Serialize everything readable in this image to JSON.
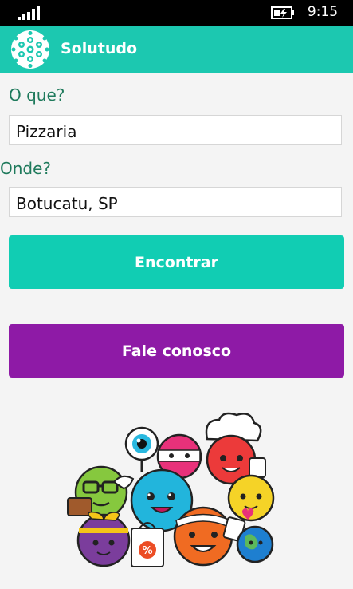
{
  "status_bar": {
    "time": "9:15",
    "signal_icon": "signal-bars-icon",
    "battery_icon": "battery-charging-icon"
  },
  "app": {
    "title": "Solutudo",
    "logo_icon": "soccer-ball-logo-icon"
  },
  "form": {
    "what_label": "O que?",
    "what_value": "Pizzaria",
    "where_label": "Onde?",
    "where_value": "Botucatu, SP"
  },
  "actions": {
    "find_label": "Encontrar",
    "contact_label": "Fale conosco"
  },
  "colors": {
    "appbar": "#1cc8b0",
    "find_button": "#11cdb3",
    "contact_button": "#8e1aa6",
    "label": "#1f7a5c"
  },
  "illustration": {
    "icon": "cartoon-mascots-illustration",
    "badge": "%"
  }
}
